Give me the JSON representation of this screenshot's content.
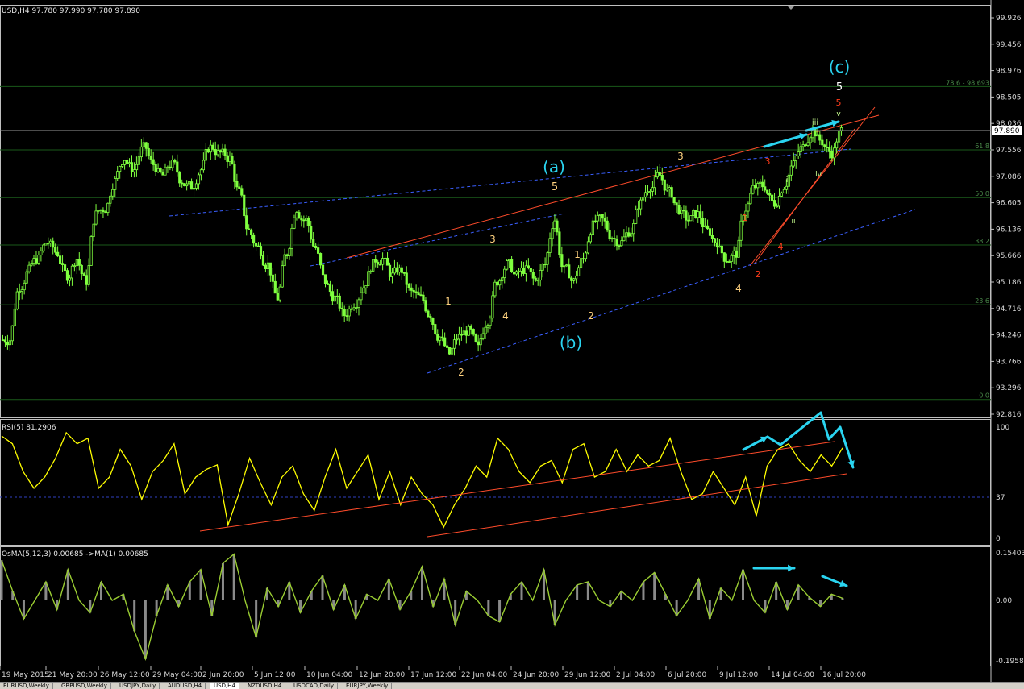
{
  "header": {
    "main": "USD,H4  97.780 97.990 97.780 97.890",
    "rsi": "RSI(5) 81.2906",
    "osma": "OsMA(5,12,3) 0.00685  ->MA(1) 0.00685"
  },
  "colors": {
    "bg": "#000000",
    "candle": "#7fff3f",
    "rsi_line": "#ffff00",
    "osma_line": "#9acd32",
    "trend": "#ff4c2b",
    "channel": "#3a5fff",
    "fib": "#1a5a1a",
    "arrow": "#2ad4f0",
    "wave_cyan": "#2ad4f0",
    "wave_yellow": "#ffd27f",
    "wave_red": "#ff3b1a",
    "wave_green": "#c8ff8f",
    "wave_white": "#ffffff"
  },
  "chart_data": [
    {
      "type": "candlestick",
      "title": "USD,H4",
      "ohlc_last": {
        "open": 97.78,
        "high": 97.99,
        "low": 97.78,
        "close": 97.89
      },
      "current_price": "97.890",
      "ylim": [
        92.816,
        99.926
      ],
      "y_ticks": [
        "99.926",
        "99.456",
        "98.976",
        "98.505",
        "98.036",
        "97.556",
        "97.086",
        "96.605",
        "96.136",
        "95.666",
        "95.186",
        "94.716",
        "94.246",
        "93.766",
        "93.296",
        "92.816"
      ],
      "x_ticks": [
        "19 May 2015",
        "21 May 20:00",
        "26 May 12:00",
        "29 May 04:00",
        "2 Jun 20:00",
        "5 Jun 12:00",
        "10 Jun 04:00",
        "12 Jun 20:00",
        "17 Jun 12:00",
        "22 Jun 04:00",
        "24 Jun 20:00",
        "29 Jun 12:00",
        "2 Jul 04:00",
        "6 Jul 20:00",
        "9 Jul 12:00",
        "14 Jul 04:00",
        "16 Jul 20:00"
      ],
      "series": [
        {
          "values": [
            94.15,
            95.1,
            95.4,
            95.6,
            95.9,
            95.7,
            95.3,
            95.6,
            95.2,
            96.4,
            96.5,
            97.0,
            97.4,
            97.2,
            97.6,
            97.3,
            97.1,
            97.3,
            97.0,
            96.9,
            97.2,
            97.6,
            97.5,
            97.4,
            96.8,
            96.1,
            95.8,
            95.5,
            94.9,
            95.7,
            96.5,
            96.3,
            95.8,
            95.2,
            94.9,
            94.6,
            94.8,
            95.1,
            95.5,
            95.6,
            95.3,
            95.4,
            95.0,
            94.9,
            94.6,
            94.2,
            93.9,
            94.2,
            94.3,
            94.0,
            94.5,
            95.2,
            95.5,
            95.3,
            95.4,
            95.2,
            95.5,
            96.3,
            95.4,
            95.2,
            95.6,
            96.2,
            96.3,
            96.0,
            95.9,
            96.1,
            96.6,
            96.9,
            97.1,
            96.8,
            96.5,
            96.3,
            96.4,
            96.1,
            95.9,
            95.6,
            95.7,
            96.5,
            96.9,
            96.9,
            96.6,
            96.9,
            97.3,
            97.6,
            97.9,
            97.7,
            97.5,
            97.9
          ]
        }
      ],
      "fib_levels": [
        {
          "label": "78.6 - 98.693",
          "value": 98.693
        },
        {
          "label": "61.8",
          "value": 97.556
        },
        {
          "label": "50.0",
          "value": 96.7
        },
        {
          "label": "38.2",
          "value": 95.85
        },
        {
          "label": "23.6",
          "value": 94.78
        },
        {
          "label": "0.0",
          "value": 93.08
        }
      ],
      "wave_labels": [
        {
          "text": "(a)",
          "color": "cyan"
        },
        {
          "text": "5",
          "color": "yellow"
        },
        {
          "text": "(b)",
          "color": "cyan"
        },
        {
          "text": "(c)",
          "color": "cyan"
        },
        {
          "text": "5",
          "color": "white"
        },
        {
          "text": "1",
          "color": "yellow"
        },
        {
          "text": "2",
          "color": "yellow"
        },
        {
          "text": "3",
          "color": "yellow"
        },
        {
          "text": "4",
          "color": "yellow"
        },
        {
          "text": "1",
          "color": "yellow"
        },
        {
          "text": "2",
          "color": "yellow"
        },
        {
          "text": "3",
          "color": "yellow"
        },
        {
          "text": "4",
          "color": "yellow"
        },
        {
          "text": "1",
          "color": "red"
        },
        {
          "text": "2",
          "color": "red"
        },
        {
          "text": "3",
          "color": "red"
        },
        {
          "text": "4",
          "color": "red"
        },
        {
          "text": "5",
          "color": "red"
        },
        {
          "text": "i",
          "color": "green"
        },
        {
          "text": "ii",
          "color": "green"
        },
        {
          "text": "iii",
          "color": "green"
        },
        {
          "text": "iv",
          "color": "green"
        },
        {
          "text": "v",
          "color": "green"
        }
      ]
    },
    {
      "type": "line",
      "title": "RSI(5) 81.2906",
      "ylim": [
        0,
        100
      ],
      "y_ticks": [
        "100",
        "37",
        "0"
      ],
      "reference_line": 37,
      "series": [
        {
          "values": [
            92,
            85,
            60,
            45,
            55,
            72,
            95,
            85,
            90,
            45,
            55,
            80,
            65,
            35,
            60,
            70,
            85,
            40,
            55,
            62,
            66,
            12,
            40,
            72,
            50,
            30,
            55,
            65,
            40,
            25,
            55,
            80,
            45,
            60,
            75,
            35,
            60,
            30,
            55,
            40,
            30,
            10,
            30,
            45,
            65,
            55,
            90,
            80,
            60,
            50,
            65,
            70,
            50,
            80,
            85,
            55,
            60,
            80,
            60,
            75,
            65,
            70,
            90,
            60,
            35,
            40,
            60,
            45,
            30,
            55,
            20,
            65,
            80,
            85,
            70,
            60,
            75,
            65,
            81.3
          ]
        }
      ]
    },
    {
      "type": "bar",
      "title": "OsMA(5,12,3) 0.00685",
      "ylim": [
        -0.19581,
        0.15403
      ],
      "y_ticks": [
        "0.15403",
        "0.00",
        "-0.19581"
      ],
      "series": [
        {
          "values": [
            0.13,
            0.03,
            -0.06,
            0.0,
            0.06,
            -0.03,
            0.1,
            0.0,
            -0.04,
            0.06,
            0.0,
            0.02,
            -0.1,
            -0.19,
            -0.05,
            0.05,
            -0.02,
            0.06,
            0.1,
            -0.05,
            0.12,
            0.15,
            0.0,
            -0.12,
            0.04,
            -0.02,
            0.06,
            -0.04,
            0.03,
            0.08,
            -0.03,
            0.05,
            -0.06,
            0.02,
            0.0,
            0.07,
            -0.03,
            0.03,
            0.11,
            -0.02,
            0.07,
            -0.08,
            0.03,
            0.0,
            -0.05,
            -0.07,
            0.02,
            0.06,
            0.0,
            0.1,
            -0.08,
            0.0,
            0.05,
            0.06,
            0.0,
            -0.02,
            0.03,
            0.0,
            0.06,
            0.09,
            0.02,
            -0.05,
            0.0,
            0.07,
            -0.06,
            0.04,
            0.0,
            0.1,
            0.0,
            -0.04,
            0.06,
            -0.03,
            0.05,
            0.01,
            -0.02,
            0.02,
            0.00685
          ]
        }
      ]
    }
  ],
  "tabs": [
    "EURUSD,Weekly",
    "GBPUSD,Weekly",
    "USDJPY,Daily",
    "AUDUSD,H4",
    "USD,H4",
    "NZDUSD,H4",
    "USDCAD,Daily",
    "EURJPY,Weekly"
  ]
}
